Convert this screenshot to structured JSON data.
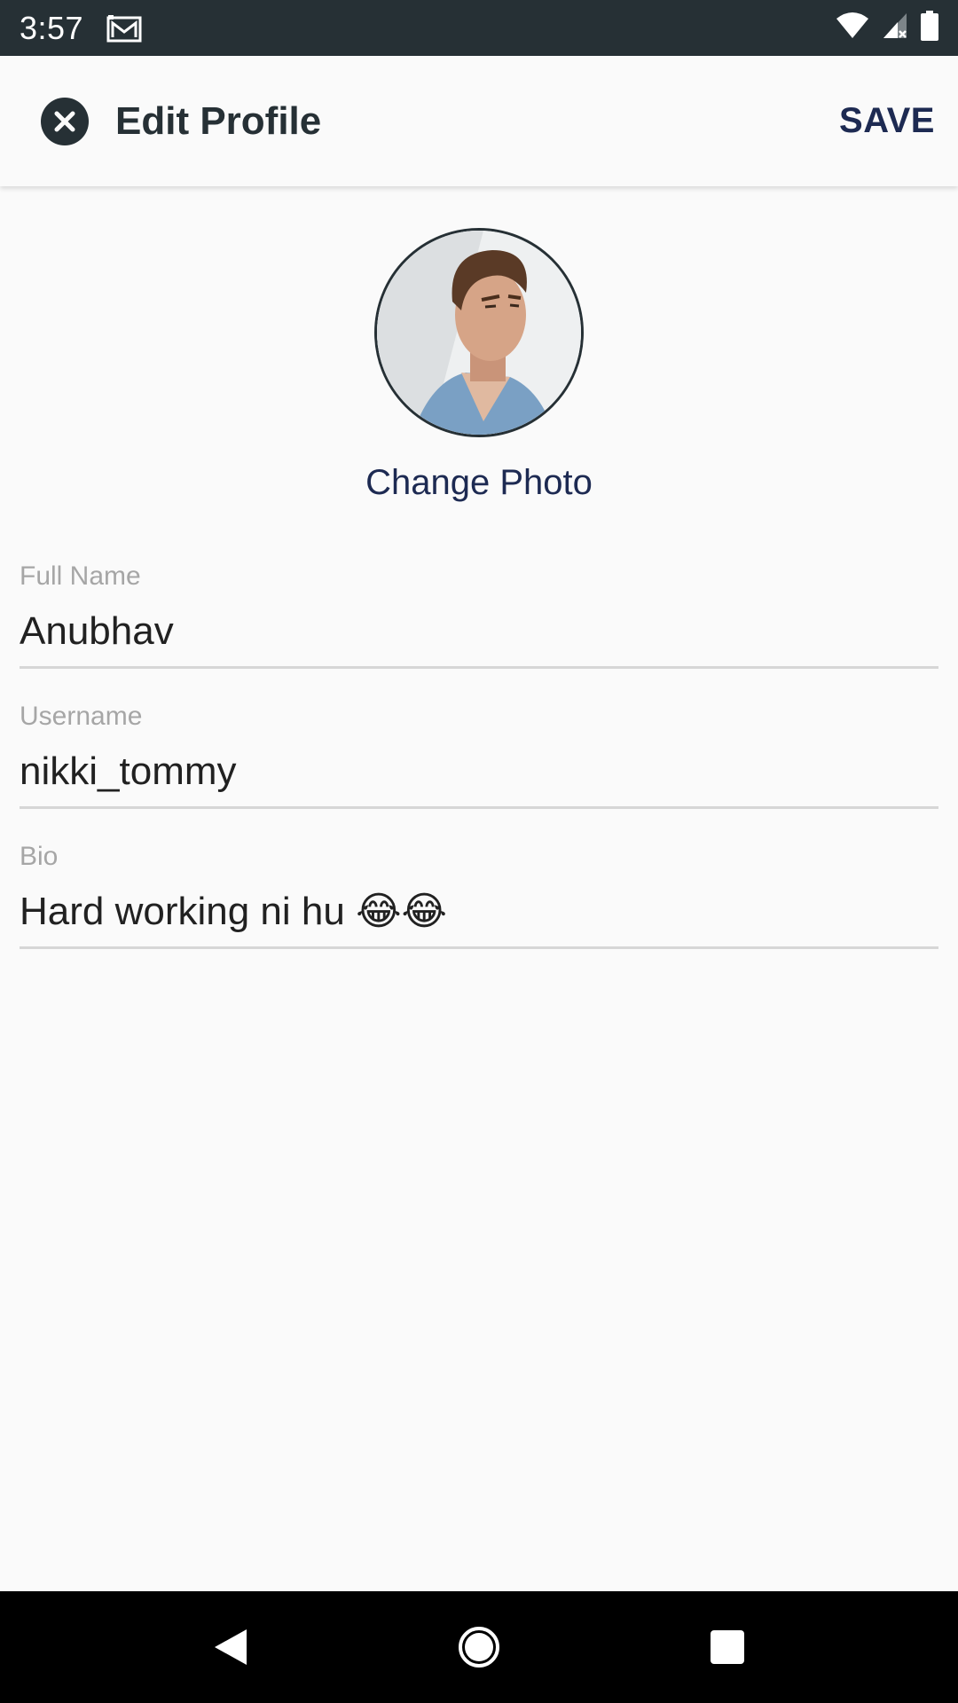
{
  "status_bar": {
    "time": "3:57",
    "icons": [
      "gmail-icon",
      "wifi-icon",
      "signal-icon",
      "battery-icon"
    ]
  },
  "app_bar": {
    "title": "Edit Profile",
    "close_icon": "close-icon",
    "save_label": "SAVE"
  },
  "profile": {
    "change_photo_label": "Change Photo"
  },
  "fields": {
    "full_name": {
      "label": "Full Name",
      "value": "Anubhav"
    },
    "username": {
      "label": "Username",
      "value": "nikki_tommy"
    },
    "bio": {
      "label": "Bio",
      "value": "Hard working ni hu 😂😂"
    }
  },
  "nav_bar": {
    "icons": [
      "back-icon",
      "home-icon",
      "recents-icon"
    ]
  },
  "colors": {
    "status_bar": "#263035",
    "accent": "#1d2a52",
    "label": "#a6a6a6",
    "divider": "#d6d6d6"
  }
}
